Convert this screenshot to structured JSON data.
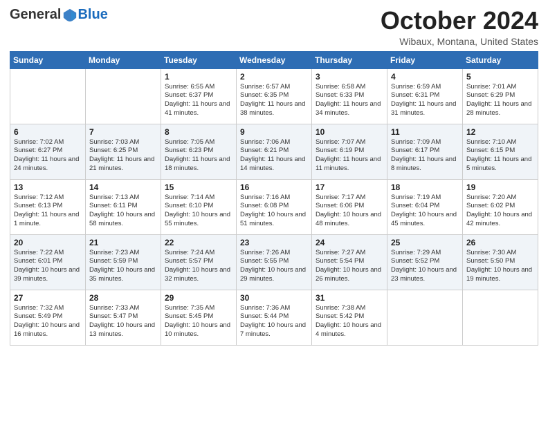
{
  "header": {
    "logo_general": "General",
    "logo_blue": "Blue",
    "title": "October 2024",
    "subtitle": "Wibaux, Montana, United States"
  },
  "days_of_week": [
    "Sunday",
    "Monday",
    "Tuesday",
    "Wednesday",
    "Thursday",
    "Friday",
    "Saturday"
  ],
  "weeks": [
    [
      {
        "day": "",
        "sunrise": "",
        "sunset": "",
        "daylight": ""
      },
      {
        "day": "",
        "sunrise": "",
        "sunset": "",
        "daylight": ""
      },
      {
        "day": "1",
        "sunrise": "Sunrise: 6:55 AM",
        "sunset": "Sunset: 6:37 PM",
        "daylight": "Daylight: 11 hours and 41 minutes."
      },
      {
        "day": "2",
        "sunrise": "Sunrise: 6:57 AM",
        "sunset": "Sunset: 6:35 PM",
        "daylight": "Daylight: 11 hours and 38 minutes."
      },
      {
        "day": "3",
        "sunrise": "Sunrise: 6:58 AM",
        "sunset": "Sunset: 6:33 PM",
        "daylight": "Daylight: 11 hours and 34 minutes."
      },
      {
        "day": "4",
        "sunrise": "Sunrise: 6:59 AM",
        "sunset": "Sunset: 6:31 PM",
        "daylight": "Daylight: 11 hours and 31 minutes."
      },
      {
        "day": "5",
        "sunrise": "Sunrise: 7:01 AM",
        "sunset": "Sunset: 6:29 PM",
        "daylight": "Daylight: 11 hours and 28 minutes."
      }
    ],
    [
      {
        "day": "6",
        "sunrise": "Sunrise: 7:02 AM",
        "sunset": "Sunset: 6:27 PM",
        "daylight": "Daylight: 11 hours and 24 minutes."
      },
      {
        "day": "7",
        "sunrise": "Sunrise: 7:03 AM",
        "sunset": "Sunset: 6:25 PM",
        "daylight": "Daylight: 11 hours and 21 minutes."
      },
      {
        "day": "8",
        "sunrise": "Sunrise: 7:05 AM",
        "sunset": "Sunset: 6:23 PM",
        "daylight": "Daylight: 11 hours and 18 minutes."
      },
      {
        "day": "9",
        "sunrise": "Sunrise: 7:06 AM",
        "sunset": "Sunset: 6:21 PM",
        "daylight": "Daylight: 11 hours and 14 minutes."
      },
      {
        "day": "10",
        "sunrise": "Sunrise: 7:07 AM",
        "sunset": "Sunset: 6:19 PM",
        "daylight": "Daylight: 11 hours and 11 minutes."
      },
      {
        "day": "11",
        "sunrise": "Sunrise: 7:09 AM",
        "sunset": "Sunset: 6:17 PM",
        "daylight": "Daylight: 11 hours and 8 minutes."
      },
      {
        "day": "12",
        "sunrise": "Sunrise: 7:10 AM",
        "sunset": "Sunset: 6:15 PM",
        "daylight": "Daylight: 11 hours and 5 minutes."
      }
    ],
    [
      {
        "day": "13",
        "sunrise": "Sunrise: 7:12 AM",
        "sunset": "Sunset: 6:13 PM",
        "daylight": "Daylight: 11 hours and 1 minute."
      },
      {
        "day": "14",
        "sunrise": "Sunrise: 7:13 AM",
        "sunset": "Sunset: 6:11 PM",
        "daylight": "Daylight: 10 hours and 58 minutes."
      },
      {
        "day": "15",
        "sunrise": "Sunrise: 7:14 AM",
        "sunset": "Sunset: 6:10 PM",
        "daylight": "Daylight: 10 hours and 55 minutes."
      },
      {
        "day": "16",
        "sunrise": "Sunrise: 7:16 AM",
        "sunset": "Sunset: 6:08 PM",
        "daylight": "Daylight: 10 hours and 51 minutes."
      },
      {
        "day": "17",
        "sunrise": "Sunrise: 7:17 AM",
        "sunset": "Sunset: 6:06 PM",
        "daylight": "Daylight: 10 hours and 48 minutes."
      },
      {
        "day": "18",
        "sunrise": "Sunrise: 7:19 AM",
        "sunset": "Sunset: 6:04 PM",
        "daylight": "Daylight: 10 hours and 45 minutes."
      },
      {
        "day": "19",
        "sunrise": "Sunrise: 7:20 AM",
        "sunset": "Sunset: 6:02 PM",
        "daylight": "Daylight: 10 hours and 42 minutes."
      }
    ],
    [
      {
        "day": "20",
        "sunrise": "Sunrise: 7:22 AM",
        "sunset": "Sunset: 6:01 PM",
        "daylight": "Daylight: 10 hours and 39 minutes."
      },
      {
        "day": "21",
        "sunrise": "Sunrise: 7:23 AM",
        "sunset": "Sunset: 5:59 PM",
        "daylight": "Daylight: 10 hours and 35 minutes."
      },
      {
        "day": "22",
        "sunrise": "Sunrise: 7:24 AM",
        "sunset": "Sunset: 5:57 PM",
        "daylight": "Daylight: 10 hours and 32 minutes."
      },
      {
        "day": "23",
        "sunrise": "Sunrise: 7:26 AM",
        "sunset": "Sunset: 5:55 PM",
        "daylight": "Daylight: 10 hours and 29 minutes."
      },
      {
        "day": "24",
        "sunrise": "Sunrise: 7:27 AM",
        "sunset": "Sunset: 5:54 PM",
        "daylight": "Daylight: 10 hours and 26 minutes."
      },
      {
        "day": "25",
        "sunrise": "Sunrise: 7:29 AM",
        "sunset": "Sunset: 5:52 PM",
        "daylight": "Daylight: 10 hours and 23 minutes."
      },
      {
        "day": "26",
        "sunrise": "Sunrise: 7:30 AM",
        "sunset": "Sunset: 5:50 PM",
        "daylight": "Daylight: 10 hours and 19 minutes."
      }
    ],
    [
      {
        "day": "27",
        "sunrise": "Sunrise: 7:32 AM",
        "sunset": "Sunset: 5:49 PM",
        "daylight": "Daylight: 10 hours and 16 minutes."
      },
      {
        "day": "28",
        "sunrise": "Sunrise: 7:33 AM",
        "sunset": "Sunset: 5:47 PM",
        "daylight": "Daylight: 10 hours and 13 minutes."
      },
      {
        "day": "29",
        "sunrise": "Sunrise: 7:35 AM",
        "sunset": "Sunset: 5:45 PM",
        "daylight": "Daylight: 10 hours and 10 minutes."
      },
      {
        "day": "30",
        "sunrise": "Sunrise: 7:36 AM",
        "sunset": "Sunset: 5:44 PM",
        "daylight": "Daylight: 10 hours and 7 minutes."
      },
      {
        "day": "31",
        "sunrise": "Sunrise: 7:38 AM",
        "sunset": "Sunset: 5:42 PM",
        "daylight": "Daylight: 10 hours and 4 minutes."
      },
      {
        "day": "",
        "sunrise": "",
        "sunset": "",
        "daylight": ""
      },
      {
        "day": "",
        "sunrise": "",
        "sunset": "",
        "daylight": ""
      }
    ]
  ]
}
